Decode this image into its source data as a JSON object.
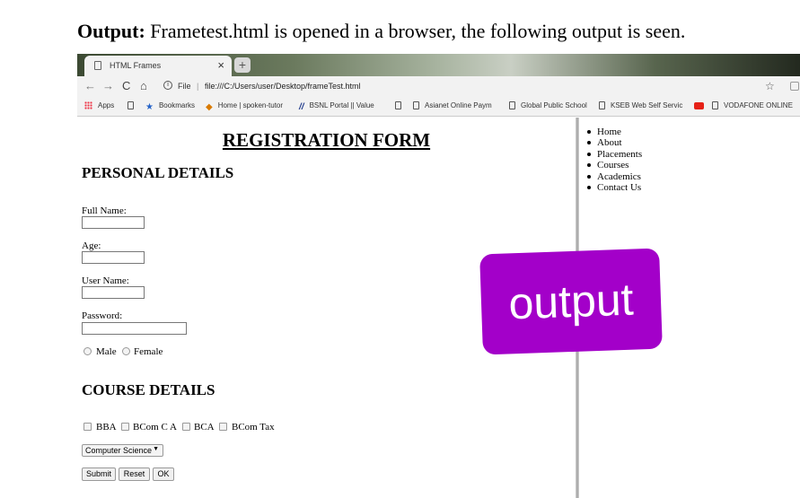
{
  "caption": {
    "bold": "Output:",
    "text": " Frametest.html is opened in a browser, the following output is seen."
  },
  "browser": {
    "tab_title": "HTML Frames",
    "tab_close": "×",
    "new_tab": "+",
    "back": "←",
    "forward": "→",
    "reload": "C",
    "home": "⌂",
    "info": "i",
    "scheme": "File",
    "separator": "|",
    "url": "file:///C:/Users/user/Desktop/frameTest.html",
    "bookmark_star": "☆",
    "bookmarks": [
      {
        "label": "Apps",
        "icon": "apps-icon"
      },
      {
        "label": "",
        "icon": "page-icon"
      },
      {
        "label": "Bookmarks",
        "icon": "star-icon"
      },
      {
        "label": "Home | spoken-tutor",
        "icon": "tutorial-icon"
      },
      {
        "label": "BSNL Portal || Value",
        "icon": "bsnl-icon"
      },
      {
        "label": "",
        "icon": "page-icon"
      },
      {
        "label": "Asianet Online Paym",
        "icon": "page-icon"
      },
      {
        "label": "Global Public School",
        "icon": "page-icon"
      },
      {
        "label": "KSEB Web Self Servic",
        "icon": "page-icon"
      },
      {
        "label": "",
        "icon": "youtube-icon"
      },
      {
        "label": "VODAFONE ONLINE",
        "icon": "page-icon"
      }
    ]
  },
  "form": {
    "title": "REGISTRATION FORM",
    "personal_heading": "PERSONAL DETAILS",
    "full_name_label": "Full Name:",
    "age_label": "Age:",
    "user_name_label": "User Name:",
    "password_label": "Password:",
    "gender_options": [
      "Male",
      "Female"
    ],
    "course_heading": "COURSE DETAILS",
    "courses": [
      "BBA",
      "BCom C A",
      "BCA",
      "BCom Tax"
    ],
    "department_selected": "Computer Science",
    "department_caret": "▼",
    "submit_label": "Submit",
    "reset_label": "Reset",
    "ok_label": "OK"
  },
  "menu": [
    "Home",
    "About",
    "Placements",
    "Courses",
    "Academics",
    "Contact Us"
  ],
  "stamp": {
    "text": "output",
    "color": "#a300c9"
  }
}
